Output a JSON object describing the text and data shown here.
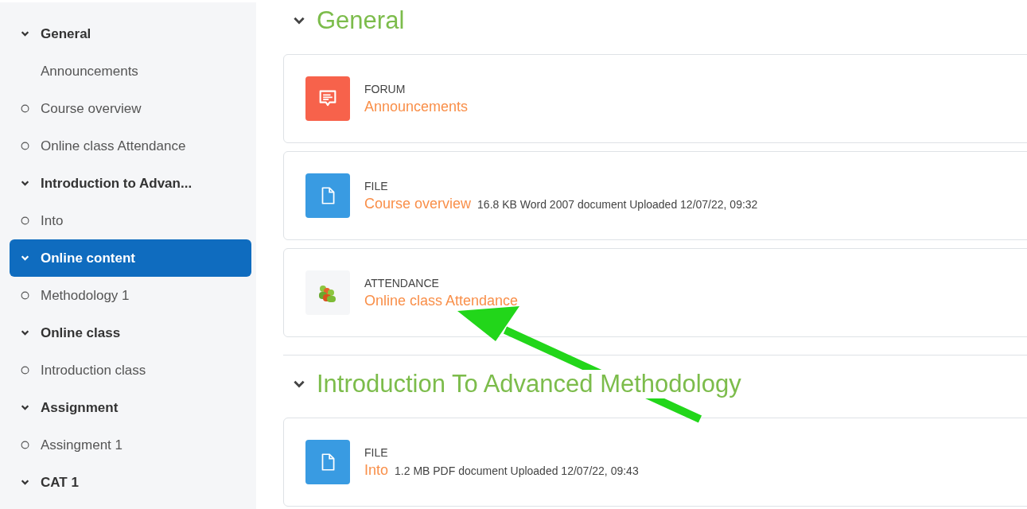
{
  "sidebar": {
    "items": [
      {
        "kind": "section",
        "label": "General",
        "expanded": true,
        "selected": false
      },
      {
        "kind": "activity",
        "label": "Announcements",
        "tracked": false
      },
      {
        "kind": "activity",
        "label": "Course overview",
        "tracked": true
      },
      {
        "kind": "activity",
        "label": "Online class Attendance",
        "tracked": true
      },
      {
        "kind": "section",
        "label": "Introduction to Advan...",
        "expanded": true,
        "selected": false
      },
      {
        "kind": "activity",
        "label": "Into",
        "tracked": true
      },
      {
        "kind": "section",
        "label": "Online content",
        "expanded": true,
        "selected": true
      },
      {
        "kind": "activity",
        "label": "Methodology 1",
        "tracked": true
      },
      {
        "kind": "section",
        "label": "Online class",
        "expanded": true,
        "selected": false
      },
      {
        "kind": "activity",
        "label": "Introduction class",
        "tracked": true
      },
      {
        "kind": "section",
        "label": "Assignment",
        "expanded": true,
        "selected": false
      },
      {
        "kind": "activity",
        "label": "Assingment 1",
        "tracked": true
      },
      {
        "kind": "section",
        "label": "CAT 1",
        "expanded": true,
        "selected": false
      }
    ]
  },
  "sections": [
    {
      "title": "General",
      "expanded": true,
      "activities": [
        {
          "kind": "forum",
          "type": "FORUM",
          "name": "Announcements"
        },
        {
          "kind": "file",
          "type": "FILE",
          "name": "Course overview",
          "details": "16.8 KB Word 2007 document Uploaded 12/07/22, 09:32"
        },
        {
          "kind": "attendance",
          "type": "ATTENDANCE",
          "name": "Online class Attendance"
        }
      ]
    },
    {
      "title": "Introduction To Advanced Methodology",
      "expanded": true,
      "activities": [
        {
          "kind": "file",
          "type": "FILE",
          "name": "Into",
          "details": "1.2 MB PDF document Uploaded 12/07/22, 09:43"
        }
      ]
    }
  ]
}
